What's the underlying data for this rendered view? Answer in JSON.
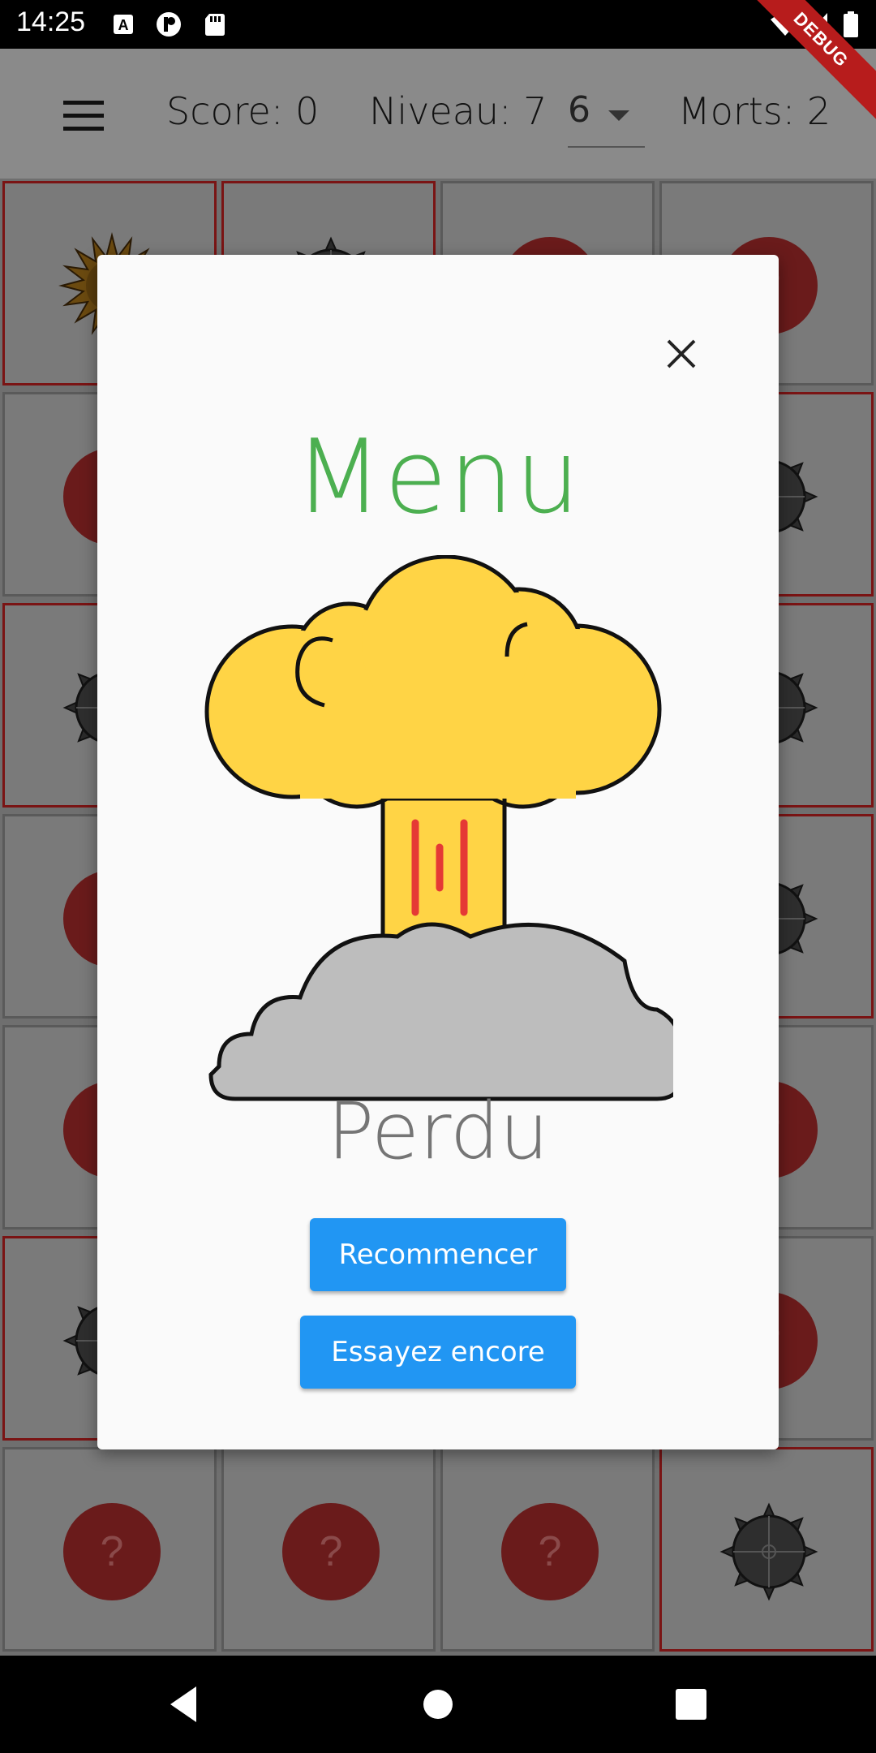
{
  "status_bar": {
    "time": "14:25",
    "icons": [
      "a-notification-icon",
      "p-notification-icon",
      "sd-card-icon",
      "wifi-icon",
      "signal-icon",
      "battery-icon"
    ],
    "debug_label": "DEBUG"
  },
  "app_bar": {
    "score": "Score: 0",
    "level": "Niveau: 7",
    "level_select_value": "6",
    "deaths": "Morts: 2"
  },
  "grid": {
    "rows": 7,
    "cols": 4,
    "cells": [
      [
        "explosion",
        "mine",
        "hidden",
        "hidden"
      ],
      [
        "hidden",
        "mine",
        "mine",
        "mine"
      ],
      [
        "mine",
        "mine",
        "mine",
        "mine"
      ],
      [
        "hidden",
        "mine",
        "mine",
        "mine"
      ],
      [
        "hidden",
        "hidden",
        "hidden",
        "hidden"
      ],
      [
        "mine",
        "hidden",
        "hidden",
        "hidden"
      ],
      [
        "hidden",
        "hidden",
        "hidden",
        "mine"
      ]
    ],
    "hidden_symbol": "?"
  },
  "dialog": {
    "title": "Menu",
    "status": "Perdu",
    "restart_label": "Recommencer",
    "retry_label": "Essayez encore",
    "image": "mushroom-cloud-explosion"
  },
  "colors": {
    "title_green": "#4caf50",
    "button_blue": "#2196f3",
    "explosion_yellow": "#ffd445",
    "smoke_gray": "#bdbdbd",
    "stripe_red": "#e53935"
  }
}
